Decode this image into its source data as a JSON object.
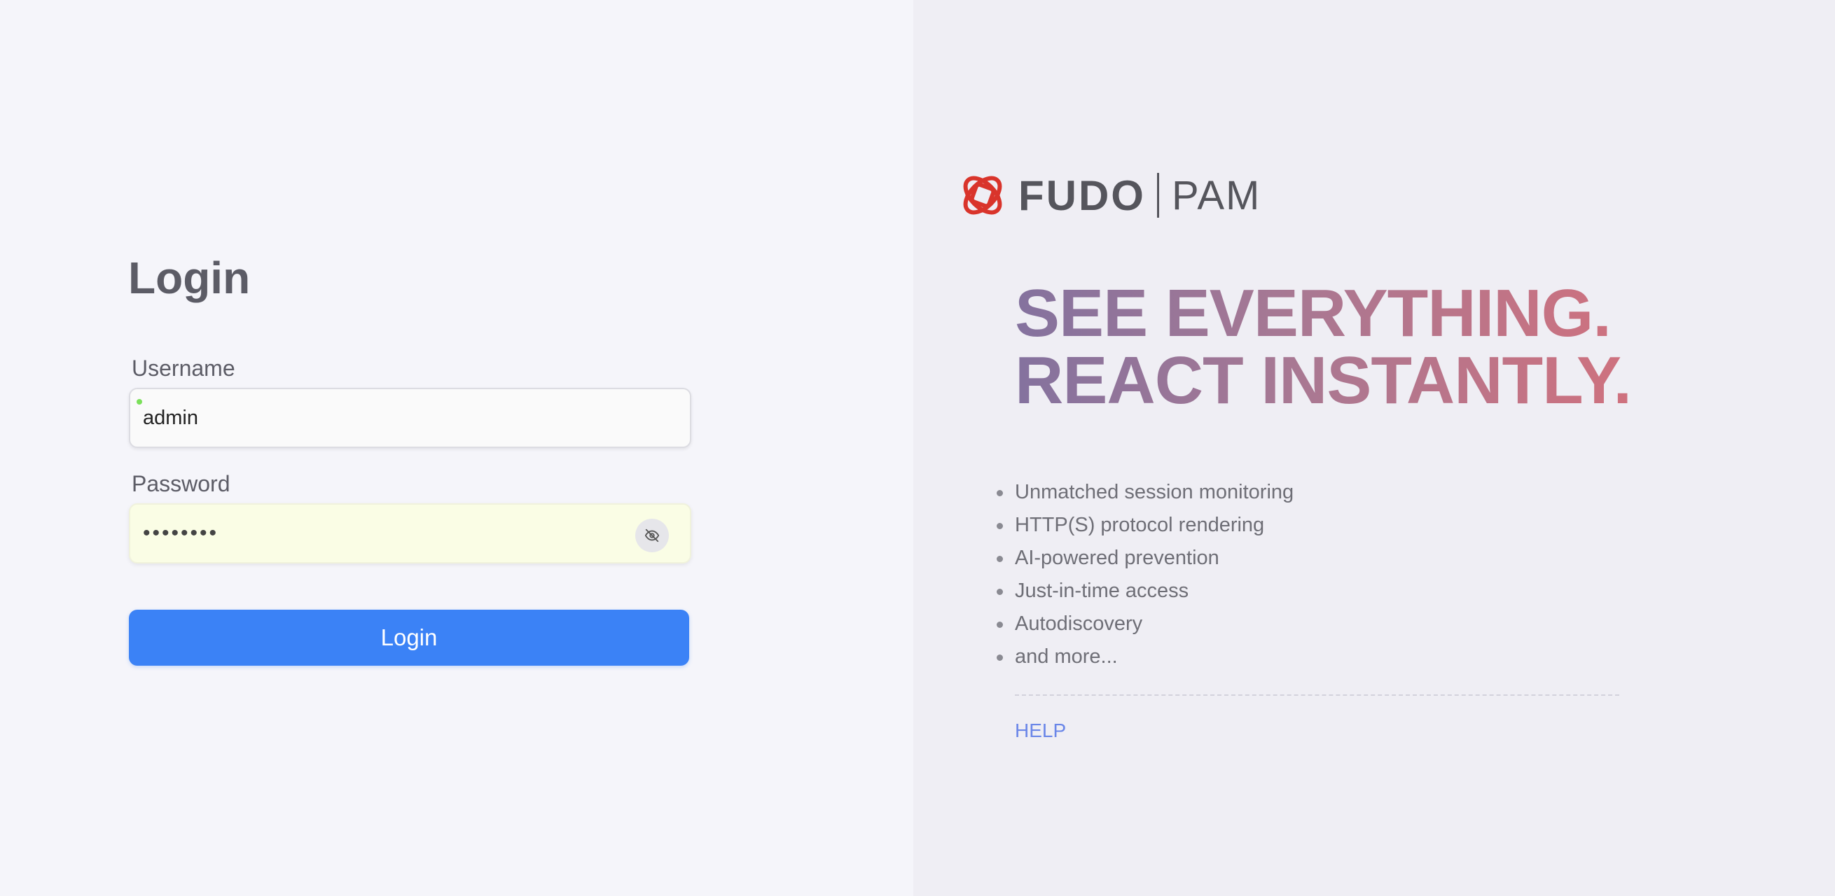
{
  "login": {
    "title": "Login",
    "username_label": "Username",
    "username_value": "admin",
    "password_label": "Password",
    "password_masked": "••••••••",
    "submit_label": "Login",
    "password_toggle_icon": "eye-off-icon"
  },
  "brand": {
    "name": "FUDO",
    "product": "PAM",
    "headline_line1": "SEE EVERYTHING.",
    "headline_line2": "REACT INSTANTLY.",
    "features": [
      "Unmatched session monitoring",
      "HTTP(S) protocol rendering",
      "AI-powered prevention",
      "Just-in-time access",
      "Autodiscovery",
      "and more..."
    ],
    "help_label": "HELP",
    "logo_color": "#d9342b"
  },
  "colors": {
    "accent": "#3b82f6",
    "link": "#6a86e8"
  }
}
